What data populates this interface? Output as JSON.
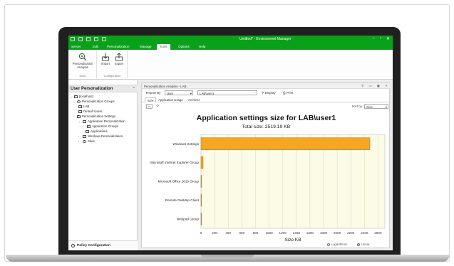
{
  "app": {
    "title": "Untitled* - Environment Manager",
    "window_buttons": [
      "–",
      "▫",
      "✕"
    ]
  },
  "menu": [
    "Server",
    "Edit",
    "Personalization",
    "Manage",
    "Tools",
    "Options",
    "Help"
  ],
  "menu_active": "Tools",
  "ribbon": {
    "tools_group": {
      "button": "Personalization Analysis",
      "label": "Tools"
    },
    "config_group": {
      "buttons": [
        "Import",
        "Export"
      ],
      "label": "Configuration"
    }
  },
  "left_panel": {
    "header": "User Personalization",
    "tree": [
      "[localhost]",
      "Personalization Groups",
      "LAB",
      "Default Users",
      "Personalization Settings",
      "Application Personalization",
      "Application Groups",
      "Applications",
      "Windows Personalization",
      "Sites"
    ],
    "footer": "Policy Configuration"
  },
  "document": {
    "tab_title": "Personalization Analysis - LAB",
    "report_by_label": "Report By",
    "report_by_value": "User",
    "user_value": "LAB\\user1",
    "display_button": "Display",
    "print_button": "Print",
    "subtabs": [
      "Size",
      "Application Usage",
      "Archives"
    ],
    "active_subtab": "Size",
    "sort_label": "Sort by",
    "sort_value": "Size",
    "scale_options": [
      "Logarithmic",
      "Linear"
    ],
    "scale_selected": "Linear"
  },
  "chart_data": {
    "type": "bar",
    "orientation": "horizontal",
    "title": "Application settings size for LAB\\user1",
    "subtitle": "Total size: 2519.19 KB",
    "categories": [
      "Windows Settings",
      "Microsoft Internet Explorer Group",
      "Microsoft Office 2010 Group",
      "Remote Desktop Client",
      "Notepad Group"
    ],
    "values": [
      2480,
      30,
      8,
      1,
      0.5
    ],
    "xlabel": "Size KB",
    "ylabel": "",
    "xlim": [
      0,
      2700
    ],
    "xticks": [
      0,
      200,
      400,
      600,
      800,
      1000,
      1200,
      1400,
      1600,
      1800,
      2000,
      2200,
      2400,
      2600
    ],
    "grid": true,
    "bar_color": "#f5a623",
    "bar_stroke": "#c27c08",
    "plot_bg": "#fbfbe6"
  },
  "colors": {
    "accent": "#0aa11a"
  }
}
